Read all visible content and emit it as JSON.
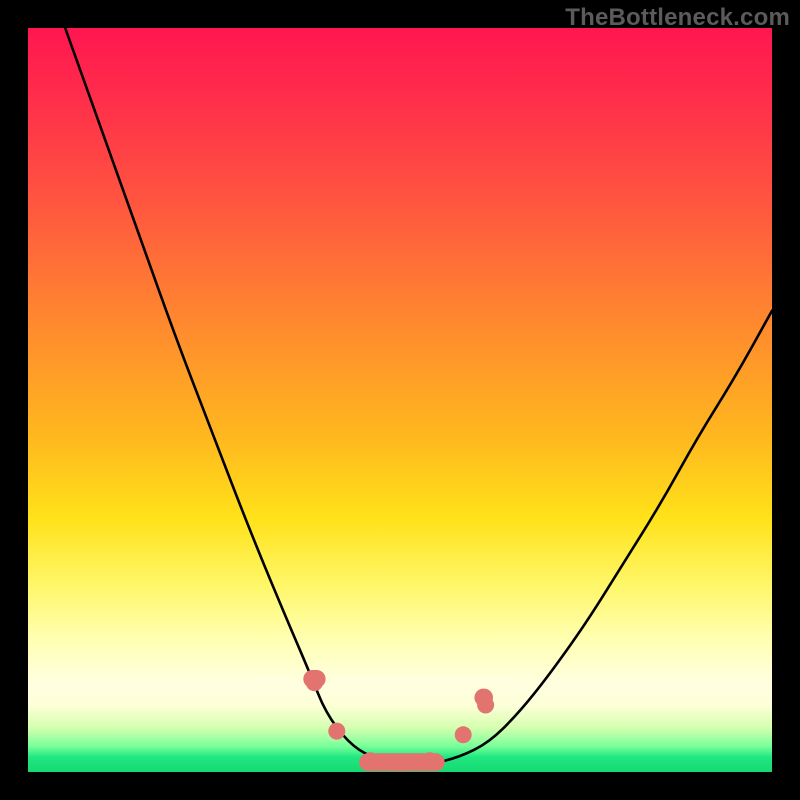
{
  "watermark": {
    "text": "TheBottleneck.com"
  },
  "chart_data": {
    "type": "line",
    "title": "",
    "xlabel": "",
    "ylabel": "",
    "xlim": [
      0,
      100
    ],
    "ylim": [
      0,
      100
    ],
    "grid": false,
    "legend": null,
    "series": [
      {
        "name": "bottleneck-curve",
        "x": [
          5,
          10,
          15,
          20,
          25,
          30,
          35,
          38,
          40,
          43,
          46,
          50,
          54,
          58,
          62,
          66,
          70,
          75,
          80,
          85,
          90,
          95,
          100
        ],
        "values": [
          100,
          86,
          72,
          58,
          45,
          32,
          20,
          13,
          8,
          4,
          2,
          1,
          1,
          2,
          4,
          8,
          13,
          20,
          28,
          36,
          45,
          53,
          62
        ]
      }
    ],
    "markers": [
      {
        "name": "marker-left-upper",
        "x": 38.5,
        "y": 12.0
      },
      {
        "name": "marker-left-mid",
        "x": 41.5,
        "y": 5.5
      },
      {
        "name": "marker-trough-a",
        "x": 46.0,
        "y": 1.5
      },
      {
        "name": "marker-trough-b",
        "x": 50.0,
        "y": 1.2
      },
      {
        "name": "marker-trough-c",
        "x": 54.0,
        "y": 1.5
      },
      {
        "name": "marker-right-mid",
        "x": 58.5,
        "y": 5.0
      },
      {
        "name": "marker-right-upper",
        "x": 61.5,
        "y": 9.0
      }
    ],
    "trough_bars": [
      {
        "name": "bar-left",
        "x0": 37.0,
        "x1": 40.0,
        "y": 12.5
      },
      {
        "name": "bar-center",
        "x0": 44.5,
        "x1": 56.0,
        "y": 1.3
      },
      {
        "name": "bar-right",
        "x0": 60.0,
        "x1": 62.5,
        "y": 10.0
      }
    ]
  }
}
